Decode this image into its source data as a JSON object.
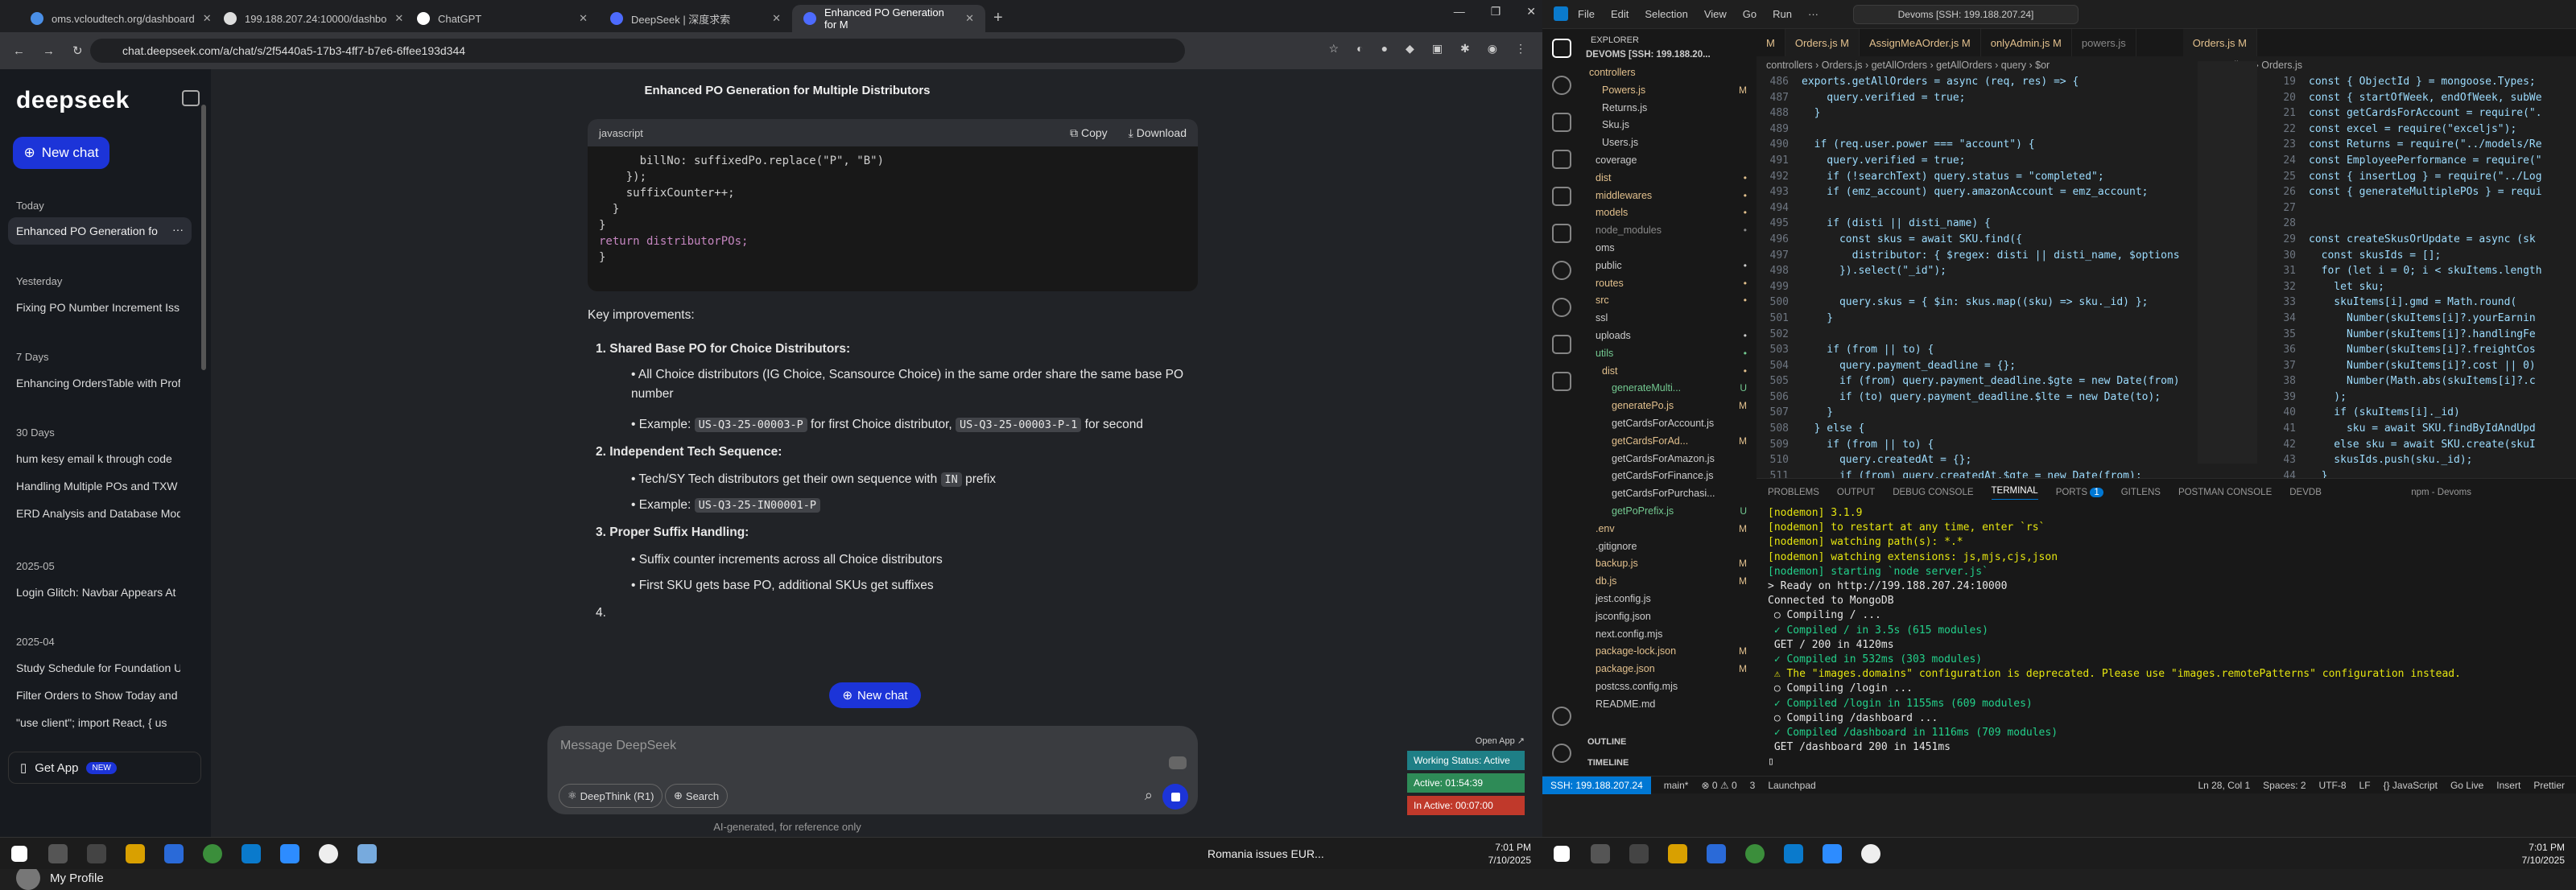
{
  "browser": {
    "tabs": [
      {
        "label": "oms.vcloudtech.org/dashboard",
        "icon": "#4a8fe7"
      },
      {
        "label": "199.188.207.24:10000/dashbo",
        "icon": "#ddd"
      },
      {
        "label": "ChatGPT",
        "icon": "#fff"
      },
      {
        "label": "DeepSeek | 深度求索",
        "icon": "#4d6bfe"
      },
      {
        "label": "Enhanced PO Generation for M",
        "icon": "#4d6bfe"
      }
    ],
    "url": "chat.deepseek.com/a/chat/s/2f5440a5-17b3-4ff7-b7e6-6ffee193d344",
    "window_controls": [
      "—",
      "❐",
      "✕"
    ]
  },
  "deepseek": {
    "logo": "deepseek",
    "new_chat": "New chat",
    "groups": [
      {
        "label": "Today",
        "items": [
          "Enhanced PO Generation fo"
        ]
      },
      {
        "label": "Yesterday",
        "items": [
          "Fixing PO Number Increment Iss"
        ]
      },
      {
        "label": "7 Days",
        "items": [
          "Enhancing OrdersTable with Prof"
        ]
      },
      {
        "label": "30 Days",
        "items": [
          "hum kesy email k through code",
          "Handling Multiple POs and TXW",
          "ERD Analysis and Database Mod"
        ]
      },
      {
        "label": "2025-05",
        "items": [
          "Login Glitch: Navbar Appears At"
        ]
      },
      {
        "label": "2025-04",
        "items": [
          "Study Schedule for Foundation U",
          "Filter Orders to Show Today and",
          "\"use client\"; import React, { us"
        ]
      }
    ],
    "get_app": "Get App",
    "new_badge": "NEW",
    "profile": "My Profile",
    "chat_title": "Enhanced PO Generation for Multiple Distributors",
    "code_lang": "javascript",
    "copy": "Copy",
    "download": "Download",
    "code_lines": [
      "      billNo: suffixedPo.replace(\"P\", \"B\")",
      "    });",
      "    suffixCounter++;",
      "  }",
      "}",
      "",
      "return distributorPOs;",
      "}"
    ],
    "key_title": "Key improvements:",
    "points": [
      {
        "n": "1.",
        "title": "Shared Base PO for Choice Distributors:",
        "bullets": [
          "All Choice distributors (IG Choice, Scansource Choice) in the same order share the same base PO number"
        ],
        "example_pre": "Example: ",
        "ex1": "US-Q3-25-00003-P",
        "mid": " for first Choice distributor, ",
        "ex2": "US-Q3-25-00003-P-1",
        "post": " for second"
      },
      {
        "n": "2.",
        "title": "Independent Tech Sequence:",
        "b1_pre": "Tech/SY Tech distributors get their own sequence with ",
        "b1_code": "IN",
        "b1_post": " prefix",
        "example_pre": "Example: ",
        "ex1": "US-Q3-25-IN00001-P"
      },
      {
        "n": "3.",
        "title": "Proper Suffix Handling:",
        "bullets": [
          "Suffix counter increments across all Choice distributors",
          "First SKU gets base PO, additional SKUs get suffixes"
        ]
      },
      {
        "n": "4."
      }
    ],
    "new_chat_center": "New chat",
    "input_placeholder": "Message DeepSeek",
    "deepthink": "DeepThink (R1)",
    "search": "Search",
    "disclaimer": "AI-generated, for reference only",
    "widget": {
      "open_app": "Open App ↗",
      "status": "Working Status: Active",
      "active": "Active: 01:54:39",
      "inactive": "In Active: 00:07:00",
      "colors": [
        "#1e7f86",
        "#2e8b57",
        "#c0392b"
      ]
    }
  },
  "left_taskbar": {
    "news": "Romania issues EUR...",
    "time": "7:01 PM",
    "date": "7/10/2025"
  },
  "vscode": {
    "menu": [
      "File",
      "Edit",
      "Selection",
      "View",
      "Go",
      "Run",
      "···"
    ],
    "search": "Devoms [SSH: 199.188.207.24]",
    "explorer_title": "EXPLORER",
    "workspace": "DEVOMS [SSH: 199.188.20...",
    "tree": [
      {
        "name": "controllers",
        "badge": "",
        "color": "#e2c08d"
      },
      {
        "name": "Powers.js",
        "badge": "M",
        "color": "#e2c08d"
      },
      {
        "name": "Returns.js",
        "badge": "",
        "color": "#ccc"
      },
      {
        "name": "Sku.js",
        "badge": "",
        "color": "#ccc"
      },
      {
        "name": "Users.js",
        "badge": "",
        "color": "#ccc"
      },
      {
        "name": "coverage",
        "badge": "",
        "color": "#ccc"
      },
      {
        "name": "dist",
        "badge": "•",
        "color": "#e2c08d"
      },
      {
        "name": "middlewares",
        "badge": "•",
        "color": "#e2c08d"
      },
      {
        "name": "models",
        "badge": "•",
        "color": "#e2c08d"
      },
      {
        "name": "node_modules",
        "badge": "•",
        "color": "#888"
      },
      {
        "name": "oms",
        "badge": "",
        "color": "#ccc"
      },
      {
        "name": "public",
        "badge": "•",
        "color": "#ccc"
      },
      {
        "name": "routes",
        "badge": "•",
        "color": "#e2c08d"
      },
      {
        "name": "src",
        "badge": "•",
        "color": "#e2c08d"
      },
      {
        "name": "ssl",
        "badge": "",
        "color": "#ccc"
      },
      {
        "name": "uploads",
        "badge": "•",
        "color": "#ccc"
      },
      {
        "name": "utils",
        "badge": "•",
        "color": "#73c991"
      },
      {
        "name": "dist",
        "badge": "•",
        "color": "#e2c08d"
      },
      {
        "name": "generateMulti...",
        "badge": "U",
        "color": "#73c991"
      },
      {
        "name": "generatePo.js",
        "badge": "M",
        "color": "#e2c08d"
      },
      {
        "name": "getCardsForAccount.js",
        "badge": "",
        "color": "#ccc"
      },
      {
        "name": "getCardsForAd...",
        "badge": "M",
        "color": "#e2c08d"
      },
      {
        "name": "getCardsForAmazon.js",
        "badge": "",
        "color": "#ccc"
      },
      {
        "name": "getCardsForFinance.js",
        "badge": "",
        "color": "#ccc"
      },
      {
        "name": "getCardsForPurchasi...",
        "badge": "",
        "color": "#ccc"
      },
      {
        "name": "getPoPrefix.js",
        "badge": "U",
        "color": "#73c991"
      },
      {
        "name": ".env",
        "badge": "M",
        "color": "#e2c08d"
      },
      {
        "name": ".gitignore",
        "badge": "",
        "color": "#ccc"
      },
      {
        "name": "backup.js",
        "badge": "M",
        "color": "#e2c08d"
      },
      {
        "name": "db.js",
        "badge": "M",
        "color": "#e2c08d"
      },
      {
        "name": "jest.config.js",
        "badge": "",
        "color": "#ccc"
      },
      {
        "name": "jsconfig.json",
        "badge": "",
        "color": "#ccc"
      },
      {
        "name": "next.config.mjs",
        "badge": "",
        "color": "#ccc"
      },
      {
        "name": "package-lock.json",
        "badge": "M",
        "color": "#e2c08d"
      },
      {
        "name": "package.json",
        "badge": "M",
        "color": "#e2c08d"
      },
      {
        "name": "postcss.config.mjs",
        "badge": "",
        "color": "#ccc"
      },
      {
        "name": "README.md",
        "badge": "",
        "color": "#ccc"
      }
    ],
    "outline": "OUTLINE",
    "timeline": "TIMELINE",
    "tabs": [
      "M",
      "Orders.js M",
      "AssignMeAOrder.js M",
      "onlyAdmin.js M",
      "powers.js",
      "Orders.js M"
    ],
    "breadcrumb": "controllers › Orders.js › getAllOrders › getAllOrders › query › $or",
    "breadcrumb2": "controllers › Orders.js",
    "code_left": [
      {
        "n": "486",
        "t": "exports.getAllOrders = async (req, res) => {"
      },
      {
        "n": "487",
        "t": "    query.verified = true;"
      },
      {
        "n": "488",
        "t": "  }"
      },
      {
        "n": "489",
        "t": ""
      },
      {
        "n": "490",
        "t": "  if (req.user.power === \"account\") {"
      },
      {
        "n": "491",
        "t": "    query.verified = true;"
      },
      {
        "n": "492",
        "t": "    if (!searchText) query.status = \"completed\";"
      },
      {
        "n": "493",
        "t": "    if (emz_account) query.amazonAccount = emz_account;"
      },
      {
        "n": "494",
        "t": ""
      },
      {
        "n": "495",
        "t": "    if (disti || disti_name) {"
      },
      {
        "n": "496",
        "t": "      const skus = await SKU.find({"
      },
      {
        "n": "497",
        "t": "        distributor: { $regex: disti || disti_name, $options"
      },
      {
        "n": "498",
        "t": "      }).select(\"_id\");"
      },
      {
        "n": "499",
        "t": ""
      },
      {
        "n": "500",
        "t": "      query.skus = { $in: skus.map((sku) => sku._id) };"
      },
      {
        "n": "501",
        "t": "    }"
      },
      {
        "n": "502",
        "t": ""
      },
      {
        "n": "503",
        "t": "    if (from || to) {"
      },
      {
        "n": "504",
        "t": "      query.payment_deadline = {};"
      },
      {
        "n": "505",
        "t": "      if (from) query.payment_deadline.$gte = new Date(from)"
      },
      {
        "n": "506",
        "t": "      if (to) query.payment_deadline.$lte = new Date(to);"
      },
      {
        "n": "507",
        "t": "    }"
      },
      {
        "n": "508",
        "t": "  } else {"
      },
      {
        "n": "509",
        "t": "    if (from || to) {"
      },
      {
        "n": "510",
        "t": "      query.createdAt = {};"
      },
      {
        "n": "511",
        "t": "      if (from) query.createdAt.$gte = new Date(from);"
      }
    ],
    "code_right": [
      {
        "n": "19",
        "t": "const { ObjectId } = mongoose.Types;"
      },
      {
        "n": "20",
        "t": "const { startOfWeek, endOfWeek, subWe"
      },
      {
        "n": "21",
        "t": "const getCardsForAccount = require(\"."
      },
      {
        "n": "22",
        "t": "const excel = require(\"exceljs\");"
      },
      {
        "n": "23",
        "t": "const Returns = require(\"../models/Re"
      },
      {
        "n": "24",
        "t": "const EmployeePerformance = require(\""
      },
      {
        "n": "25",
        "t": "const { insertLog } = require(\"../Log"
      },
      {
        "n": "26",
        "t": "const { generateMultiplePOs } = requi"
      },
      {
        "n": "27",
        "t": ""
      },
      {
        "n": "28",
        "t": ""
      },
      {
        "n": "29",
        "t": "const createSkusOrUpdate = async (sk"
      },
      {
        "n": "30",
        "t": "  const skusIds = [];"
      },
      {
        "n": "31",
        "t": "  for (let i = 0; i < skuItems.length"
      },
      {
        "n": "32",
        "t": "    let sku;"
      },
      {
        "n": "33",
        "t": "    skuItems[i].gmd = Math.round("
      },
      {
        "n": "34",
        "t": "      Number(skuItems[i]?.yourEarnin"
      },
      {
        "n": "35",
        "t": "      Number(skuItems[i]?.handlingFe"
      },
      {
        "n": "36",
        "t": "      Number(skuItems[i]?.freightCos"
      },
      {
        "n": "37",
        "t": "      Number(skuItems[i]?.cost || 0)"
      },
      {
        "n": "38",
        "t": "      Number(Math.abs(skuItems[i]?.c"
      },
      {
        "n": "39",
        "t": "    );"
      },
      {
        "n": "40",
        "t": "    if (skuItems[i]._id)"
      },
      {
        "n": "41",
        "t": "      sku = await SKU.findByIdAndUpd"
      },
      {
        "n": "42",
        "t": "    else sku = await SKU.create(skuI"
      },
      {
        "n": "43",
        "t": "    skusIds.push(sku._id);"
      },
      {
        "n": "44",
        "t": "  }"
      }
    ],
    "panel_tabs": [
      "PROBLEMS",
      "OUTPUT",
      "DEBUG CONSOLE",
      "TERMINAL",
      "PORTS",
      "GITLENS",
      "POSTMAN CONSOLE",
      "DEVDB"
    ],
    "ports_count": "1",
    "terminal_name": "npm - Devoms",
    "terminal": [
      {
        "t": "[nodemon] 3.1.9",
        "c": "y"
      },
      {
        "t": "[nodemon] to restart at any time, enter `rs`",
        "c": "y"
      },
      {
        "t": "[nodemon] watching path(s): *.*",
        "c": "y"
      },
      {
        "t": "[nodemon] watching extensions: js,mjs,cjs,json",
        "c": "y"
      },
      {
        "t": "[nodemon] starting `node server.js`",
        "c": "g"
      },
      {
        "t": "> Ready on http://199.188.207.24:10000",
        "c": "w"
      },
      {
        "t": "Connected to MongoDB",
        "c": "w"
      },
      {
        "t": " ○ Compiling / ...",
        "c": "w"
      },
      {
        "t": " ✓ Compiled / in 3.5s (615 modules)",
        "c": "g"
      },
      {
        "t": " GET / 200 in 4120ms",
        "c": "w"
      },
      {
        "t": " ✓ Compiled in 532ms (303 modules)",
        "c": "g"
      },
      {
        "t": " ⚠ The \"images.domains\" configuration is deprecated. Please use \"images.remotePatterns\" configuration instead.",
        "c": "y"
      },
      {
        "t": " ○ Compiling /login ...",
        "c": "w"
      },
      {
        "t": " ✓ Compiled /login in 1155ms (609 modules)",
        "c": "g"
      },
      {
        "t": " ○ Compiling /dashboard ...",
        "c": "w"
      },
      {
        "t": " ✓ Compiled /dashboard in 1116ms (709 modules)",
        "c": "g"
      },
      {
        "t": " GET /dashboard 200 in 1451ms",
        "c": "w"
      },
      {
        "t": "▯",
        "c": "w"
      }
    ],
    "status": {
      "remote": "SSH: 199.188.207.24",
      "branch": "main*",
      "errors": "⊗ 0 ⚠ 0",
      "ports": "3",
      "launch": "Launchpad",
      "pos": "Ln 28, Col 1",
      "spaces": "Spaces: 2",
      "enc": "UTF-8",
      "eol": "LF",
      "lang": "{} JavaScript",
      "golive": "Go Live",
      "insert": "Insert",
      "prettier": "Prettier"
    },
    "taskbar": {
      "time": "7:01 PM",
      "date": "7/10/2025"
    }
  }
}
